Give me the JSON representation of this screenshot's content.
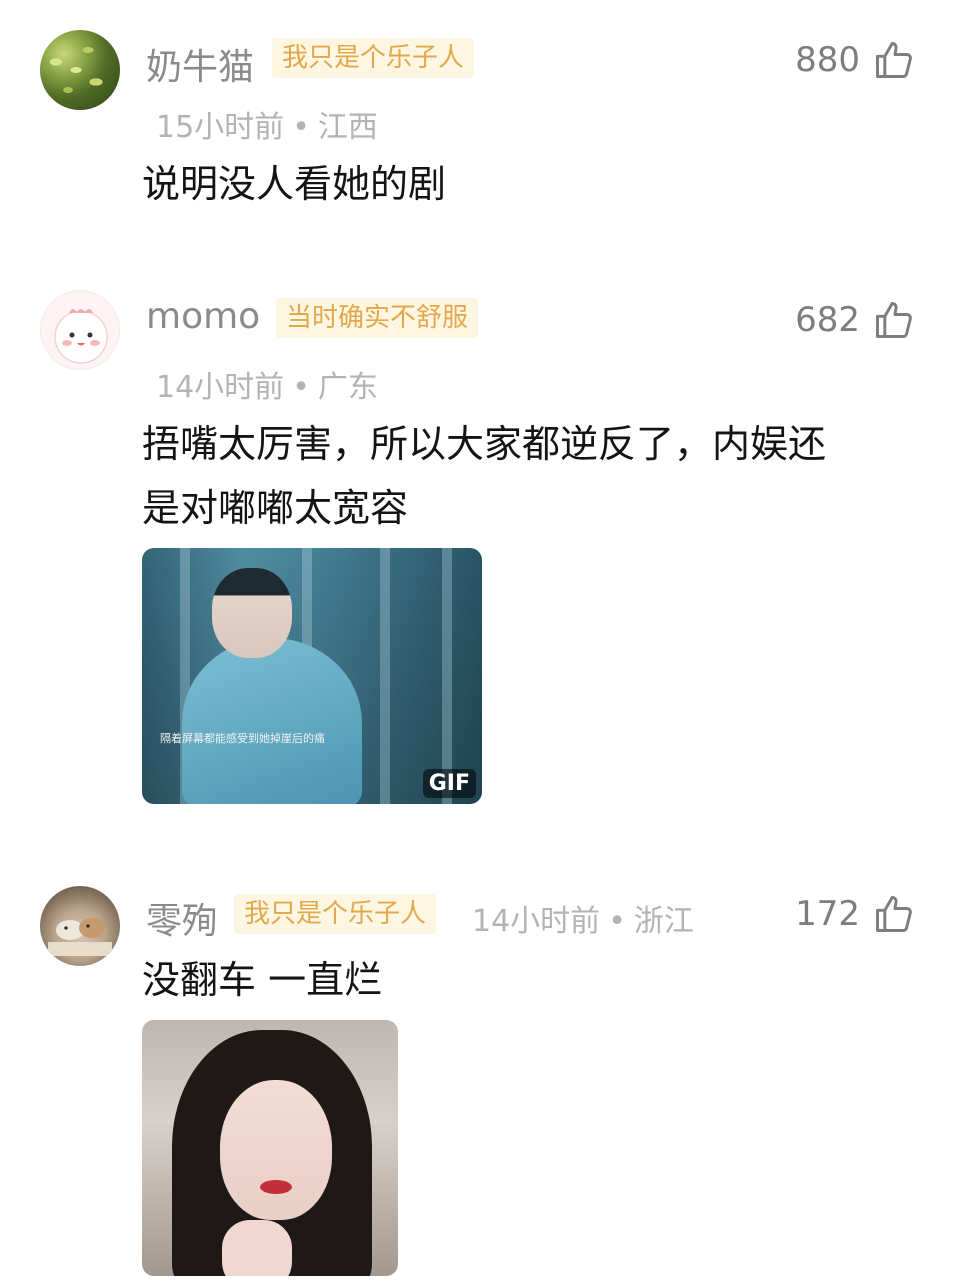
{
  "comments": [
    {
      "username": "奶牛猫",
      "badge": "我只是个乐子人",
      "time": "15小时前",
      "location": "江西",
      "likes": "880",
      "text": "说明没人看她的剧"
    },
    {
      "username": "momo",
      "badge": "当时确实不舒服",
      "time": "14小时前",
      "location": "广东",
      "likes": "682",
      "text_line1": "捂嘴太厉害，所以大家都逆反了，内娱还",
      "text_line2": "是对嘟嘟太宽容",
      "gif_caption": "隔着屏幕都能感受到她掉崖后的痛",
      "gif_tag": "GIF"
    },
    {
      "username": "零殉",
      "badge": "我只是个乐子人",
      "time": "14小时前",
      "location": "浙江",
      "likes": "172",
      "text": "没翻车 一直烂"
    }
  ],
  "separator": "•",
  "icons": {
    "like": "thumbs-up-icon"
  },
  "colors": {
    "username": "#8a8a8a",
    "badge_text": "#e3a84a",
    "badge_bg": "#fdf6e3",
    "meta": "#b3b3b3",
    "body_text": "#141414"
  }
}
